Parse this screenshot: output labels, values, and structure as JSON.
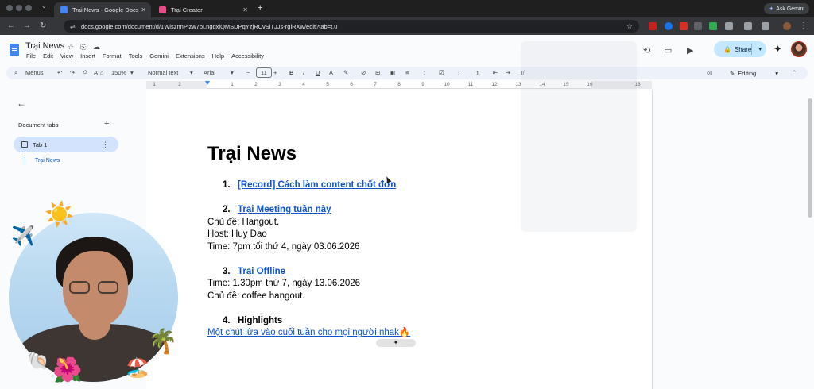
{
  "browser": {
    "tabs": [
      {
        "title": "Trại News - Google Docs"
      },
      {
        "title": "Trại Creator"
      }
    ],
    "url": "docs.google.com/document/d/1WisznnPlzw7oLngqxjQMSDPqYzjRCvSlTJJs-rglRXw/edit?tab=t.0",
    "ask_gemini": "Ask Gemini"
  },
  "docs": {
    "title": "Trại News",
    "menu": [
      "File",
      "Edit",
      "View",
      "Insert",
      "Format",
      "Tools",
      "Gemini",
      "Extensions",
      "Help",
      "Accessibility"
    ],
    "share_label": "Share",
    "toolbar": {
      "menus": "Menus",
      "zoom": "150%",
      "style": "Normal text",
      "font": "Arial",
      "font_size": "11",
      "mode": "Editing"
    },
    "ruler_numbers": [
      "1",
      "2",
      "1",
      "2",
      "3",
      "4",
      "5",
      "6",
      "7",
      "8",
      "9",
      "10",
      "11",
      "12",
      "13",
      "14",
      "15",
      "16",
      "18"
    ]
  },
  "sidebar": {
    "heading": "Document tabs",
    "tab_label": "Tab 1",
    "outline_item": "Trại News"
  },
  "document": {
    "heading": "Trại News",
    "items": [
      {
        "num": "1.",
        "text": "[Record] Cách làm content chốt đơn"
      },
      {
        "num": "2.",
        "text": "Trại Meeting tuần này"
      },
      {
        "num": "3.",
        "text": "Trại Offline"
      },
      {
        "num": "4.",
        "text": "Highlights"
      }
    ],
    "meeting_lines": [
      "Chủ đề: Hangout.",
      "Host: Huy Dao",
      "Time: 7pm tối thứ 4, ngày 03.06.2026"
    ],
    "offline_lines": [
      "Time: 1.30pm thứ 7, ngày 13.06.2026",
      "Chủ đề: coffee hangout."
    ],
    "highlight_link": "Một chút lửa vào cuối tuần cho mọi người nhak🔥"
  }
}
